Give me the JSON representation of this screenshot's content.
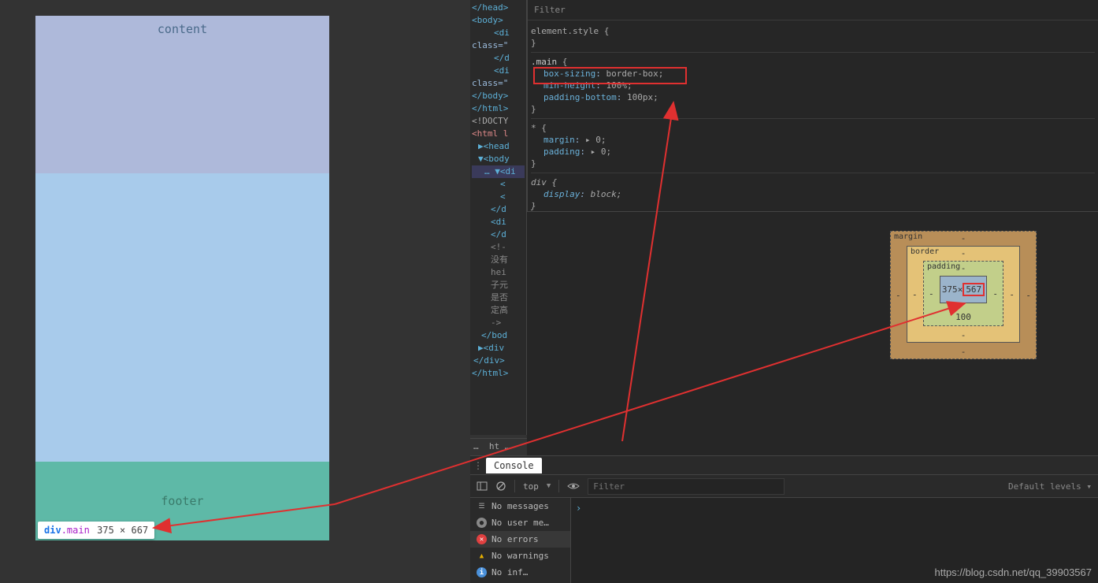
{
  "preview": {
    "content_label": "content",
    "footer_label": "footer"
  },
  "tooltip": {
    "tag": "div",
    "cls": ".main",
    "dims": "375 × 667"
  },
  "dom": {
    "lines": [
      "</head>",
      "<body>",
      "  <di",
      "",
      "class=\"",
      "",
      "  </d",
      "  <di",
      "class=\"",
      "</body>",
      "</html>",
      "<!DOCTY",
      "<html l",
      "▶<head",
      "▼<body",
      "… ▼<di",
      "    <",
      "    <",
      "  </d",
      "  <di",
      "  </d",
      "  <!-",
      "  没有",
      "  hei",
      "  子元",
      "  是否",
      "  定高",
      "  ->",
      "",
      "</bod",
      "▶<div",
      "</div>",
      "</html>"
    ]
  },
  "breadcrumb": {
    "items": [
      "…",
      "ht",
      "…"
    ]
  },
  "styles": {
    "filter_label": "Filter",
    "rules": [
      {
        "selector": "element.style",
        "props": []
      },
      {
        "selector": ".main",
        "props": [
          {
            "name": "box-sizing",
            "value": "border-box;"
          },
          {
            "name": "min-height",
            "value": "100%;"
          },
          {
            "name": "padding-bottom",
            "value": "100px;"
          }
        ]
      },
      {
        "selector": "*",
        "props": [
          {
            "name": "margin",
            "value": "▸ 0;"
          },
          {
            "name": "padding",
            "value": "▸ 0;"
          }
        ]
      },
      {
        "selector": "div",
        "props": [
          {
            "name": "display",
            "value": "block;",
            "italic": true
          }
        ]
      }
    ]
  },
  "box_model": {
    "margin_label": "margin",
    "border_label": "border",
    "padding_label": "padding",
    "width": "375",
    "height": "567",
    "padding_bottom": "100",
    "dash": "-"
  },
  "console": {
    "tab": "Console",
    "context": "top",
    "filter_placeholder": "Filter",
    "levels": "Default levels ▾",
    "sidebar": [
      {
        "icon": "list",
        "label": "No messages"
      },
      {
        "icon": "user",
        "label": "No user me…"
      },
      {
        "icon": "error",
        "label": "No errors"
      },
      {
        "icon": "warn",
        "label": "No warnings"
      },
      {
        "icon": "info",
        "label": "No inf…"
      }
    ],
    "prompt": "›"
  },
  "watermark": "https://blog.csdn.net/qq_39903567"
}
